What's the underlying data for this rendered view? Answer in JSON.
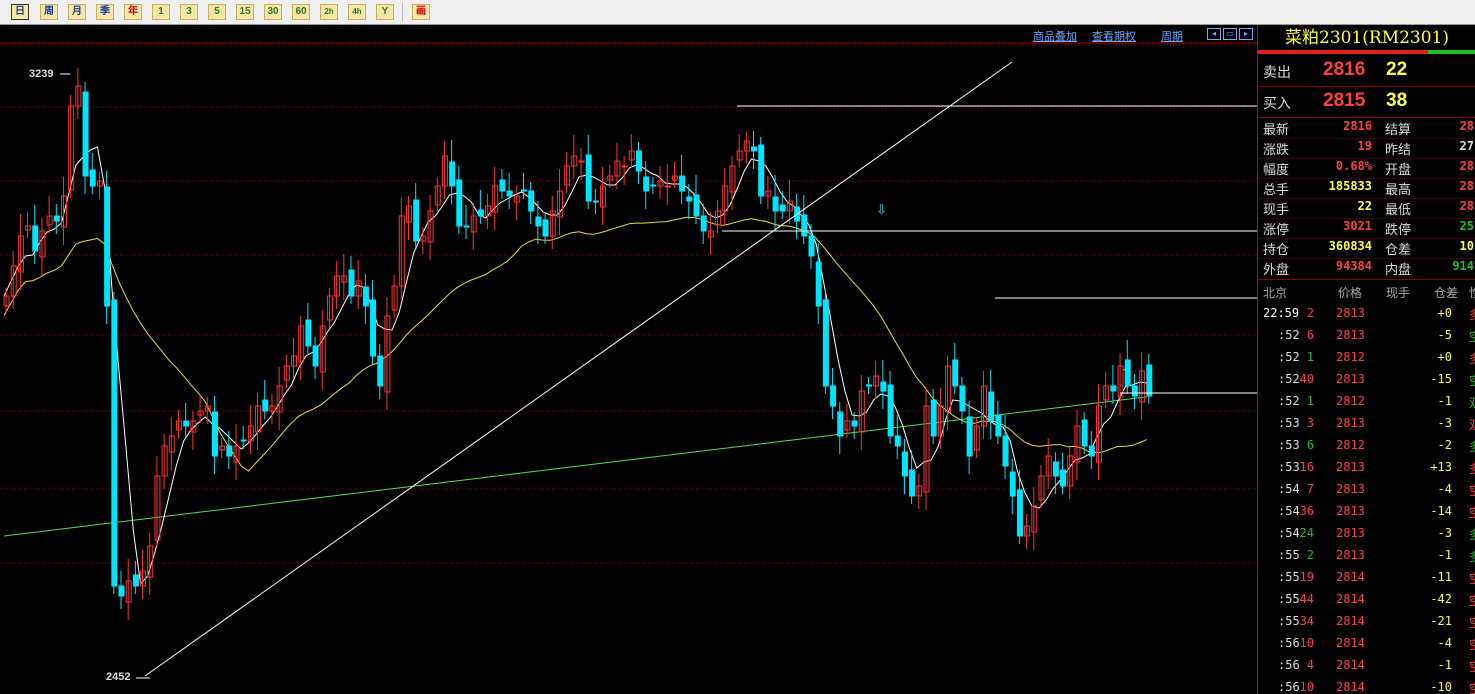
{
  "toolbar": {
    "buttons": [
      "日",
      "周",
      "月",
      "季",
      "年",
      "1",
      "3",
      "5",
      "15",
      "30",
      "60",
      "2h",
      "4h",
      "Y",
      "画"
    ]
  },
  "chart": {
    "links": {
      "overlay": "商品叠加",
      "rights": "查看期权",
      "period": "周期"
    },
    "high_label": "3239",
    "low_label": "2452",
    "colors": {
      "up": "#ff3232",
      "down": "#00e5ff",
      "ma5": "#ffffff",
      "ma20": "#e8e030",
      "ma60": "#50e050",
      "grid": "#8a0000"
    }
  },
  "panel": {
    "title": "菜粕2301(RM2301)",
    "sell": {
      "label": "卖出",
      "price": "2816",
      "vol": "22"
    },
    "buy": {
      "label": "买入",
      "price": "2815",
      "vol": "38"
    },
    "stats": [
      {
        "l1": "最新",
        "v1": "2816",
        "c1": "#ff4040",
        "l2": "结算",
        "v2": "28",
        "c2": "#ff4040"
      },
      {
        "l1": "涨跌",
        "v1": "19",
        "c1": "#ff4040",
        "l2": "昨结",
        "v2": "27",
        "c2": "#dddddd"
      },
      {
        "l1": "幅度",
        "v1": "0.68%",
        "c1": "#ff4040",
        "l2": "开盘",
        "v2": "28",
        "c2": "#ff4040"
      },
      {
        "l1": "总手",
        "v1": "185833",
        "c1": "#ffff44",
        "l2": "最高",
        "v2": "28",
        "c2": "#ff4040"
      },
      {
        "l1": "现手",
        "v1": "22",
        "c1": "#ffff44",
        "l2": "最低",
        "v2": "28",
        "c2": "#ff4040"
      },
      {
        "l1": "涨停",
        "v1": "3021",
        "c1": "#ff4040",
        "l2": "跌停",
        "v2": "25",
        "c2": "#20c020"
      },
      {
        "l1": "持仓",
        "v1": "360834",
        "c1": "#ffff44",
        "l2": "仓差",
        "v2": "10",
        "c2": "#ffff44"
      },
      {
        "l1": "外盘",
        "v1": "94384",
        "c1": "#ff4040",
        "l2": "内盘",
        "v2": "914",
        "c2": "#20c020"
      }
    ],
    "ticks_header": {
      "time": "北京",
      "price": "价格",
      "vol": "现手",
      "oi": "仓差",
      "nature": "性"
    },
    "ticks": [
      {
        "t": "22:59",
        "p": "2813",
        "v": "2",
        "v_c": "#ff4040",
        "d": "+0",
        "d_c": "#ffff44",
        "n": "多",
        "n_c": "#ff4040"
      },
      {
        "t": ":52",
        "p": "2813",
        "v": "6",
        "v_c": "#ff4040",
        "d": "-5",
        "d_c": "#ffff44",
        "n": "空",
        "n_c": "#20c020"
      },
      {
        "t": ":52",
        "p": "2812",
        "v": "1",
        "v_c": "#20c020",
        "d": "+0",
        "d_c": "#ffff44",
        "n": "多",
        "n_c": "#ff4040"
      },
      {
        "t": ":52",
        "p": "2813",
        "v": "40",
        "v_c": "#ff4040",
        "d": "-15",
        "d_c": "#ffff44",
        "n": "空",
        "n_c": "#20c020"
      },
      {
        "t": ":52",
        "p": "2812",
        "v": "1",
        "v_c": "#20c020",
        "d": "-1",
        "d_c": "#ffff44",
        "n": "双",
        "n_c": "#20c020"
      },
      {
        "t": ":53",
        "p": "2813",
        "v": "3",
        "v_c": "#ff4040",
        "d": "-3",
        "d_c": "#ffff44",
        "n": "双",
        "n_c": "#ff4040"
      },
      {
        "t": ":53",
        "p": "2812",
        "v": "6",
        "v_c": "#20c020",
        "d": "-2",
        "d_c": "#ffff44",
        "n": "多",
        "n_c": "#20c020"
      },
      {
        "t": ":53",
        "p": "2813",
        "v": "16",
        "v_c": "#ff4040",
        "d": "+13",
        "d_c": "#ffff44",
        "n": "多",
        "n_c": "#ff4040"
      },
      {
        "t": ":54",
        "p": "2813",
        "v": "7",
        "v_c": "#ff4040",
        "d": "-4",
        "d_c": "#ffff44",
        "n": "空",
        "n_c": "#ff4040"
      },
      {
        "t": ":54",
        "p": "2813",
        "v": "36",
        "v_c": "#ff4040",
        "d": "-14",
        "d_c": "#ffff44",
        "n": "空",
        "n_c": "#ff4040"
      },
      {
        "t": ":54",
        "p": "2813",
        "v": "24",
        "v_c": "#20c020",
        "d": "-3",
        "d_c": "#ffff44",
        "n": "多",
        "n_c": "#20c020"
      },
      {
        "t": ":55",
        "p": "2813",
        "v": "2",
        "v_c": "#20c020",
        "d": "-1",
        "d_c": "#ffff44",
        "n": "多",
        "n_c": "#20c020"
      },
      {
        "t": ":55",
        "p": "2814",
        "v": "19",
        "v_c": "#ff4040",
        "d": "-11",
        "d_c": "#ffff44",
        "n": "空",
        "n_c": "#ff4040"
      },
      {
        "t": ":55",
        "p": "2814",
        "v": "44",
        "v_c": "#ff4040",
        "d": "-42",
        "d_c": "#ffff44",
        "n": "空",
        "n_c": "#ff4040"
      },
      {
        "t": ":55",
        "p": "2814",
        "v": "34",
        "v_c": "#ff4040",
        "d": "-21",
        "d_c": "#ffff44",
        "n": "空",
        "n_c": "#ff4040"
      },
      {
        "t": ":56",
        "p": "2814",
        "v": "10",
        "v_c": "#ff4040",
        "d": "-4",
        "d_c": "#ffff44",
        "n": "空",
        "n_c": "#ff4040"
      },
      {
        "t": ":56",
        "p": "2814",
        "v": "4",
        "v_c": "#ff4040",
        "d": "-1",
        "d_c": "#ffff44",
        "n": "空",
        "n_c": "#ff4040"
      },
      {
        "t": ":56",
        "p": "2814",
        "v": "10",
        "v_c": "#ff4040",
        "d": "-10",
        "d_c": "#ffff44",
        "n": "空",
        "n_c": "#ff4040"
      }
    ]
  }
}
